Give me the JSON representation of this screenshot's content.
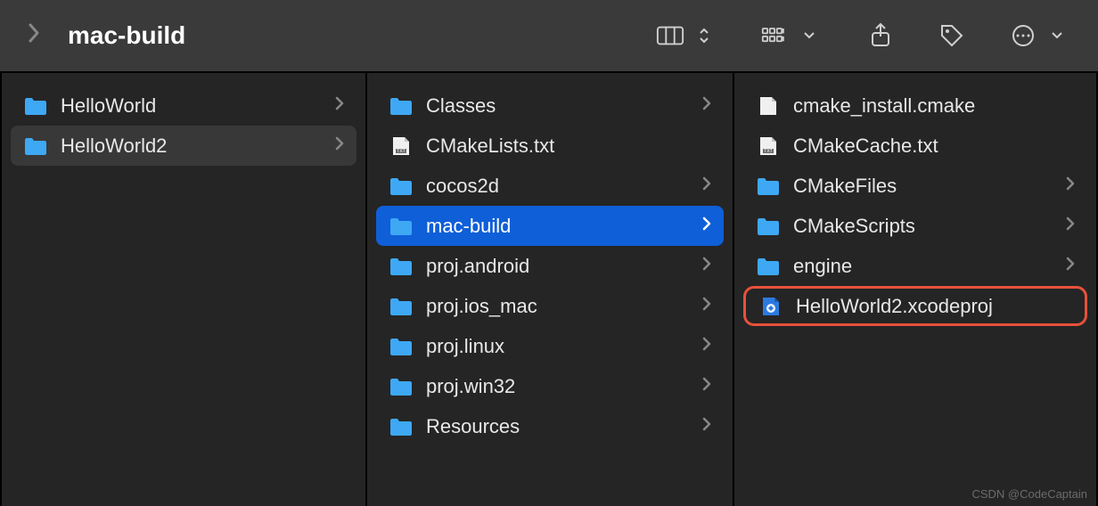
{
  "toolbar": {
    "title": "mac-build"
  },
  "columns": [
    {
      "items": [
        {
          "label": "HelloWorld",
          "type": "folder",
          "hasChildren": true,
          "state": "normal"
        },
        {
          "label": "HelloWorld2",
          "type": "folder",
          "hasChildren": true,
          "state": "hovered"
        }
      ]
    },
    {
      "items": [
        {
          "label": "Classes",
          "type": "folder",
          "hasChildren": true,
          "state": "normal"
        },
        {
          "label": "CMakeLists.txt",
          "type": "txtfile",
          "hasChildren": false,
          "state": "normal"
        },
        {
          "label": "cocos2d",
          "type": "folder",
          "hasChildren": true,
          "state": "normal"
        },
        {
          "label": "mac-build",
          "type": "folder",
          "hasChildren": true,
          "state": "selected"
        },
        {
          "label": "proj.android",
          "type": "folder",
          "hasChildren": true,
          "state": "normal"
        },
        {
          "label": "proj.ios_mac",
          "type": "folder",
          "hasChildren": true,
          "state": "normal"
        },
        {
          "label": "proj.linux",
          "type": "folder",
          "hasChildren": true,
          "state": "normal"
        },
        {
          "label": "proj.win32",
          "type": "folder",
          "hasChildren": true,
          "state": "normal"
        },
        {
          "label": "Resources",
          "type": "folder",
          "hasChildren": true,
          "state": "normal"
        }
      ]
    },
    {
      "items": [
        {
          "label": "cmake_install.cmake",
          "type": "file",
          "hasChildren": false,
          "state": "normal"
        },
        {
          "label": "CMakeCache.txt",
          "type": "txtfile",
          "hasChildren": false,
          "state": "normal"
        },
        {
          "label": "CMakeFiles",
          "type": "folder",
          "hasChildren": true,
          "state": "normal"
        },
        {
          "label": "CMakeScripts",
          "type": "folder",
          "hasChildren": true,
          "state": "normal"
        },
        {
          "label": "engine",
          "type": "folder",
          "hasChildren": true,
          "state": "normal"
        },
        {
          "label": "HelloWorld2.xcodeproj",
          "type": "xcodeproj",
          "hasChildren": false,
          "state": "highlighted"
        }
      ]
    }
  ],
  "watermark": "CSDN @CodeCaptain"
}
